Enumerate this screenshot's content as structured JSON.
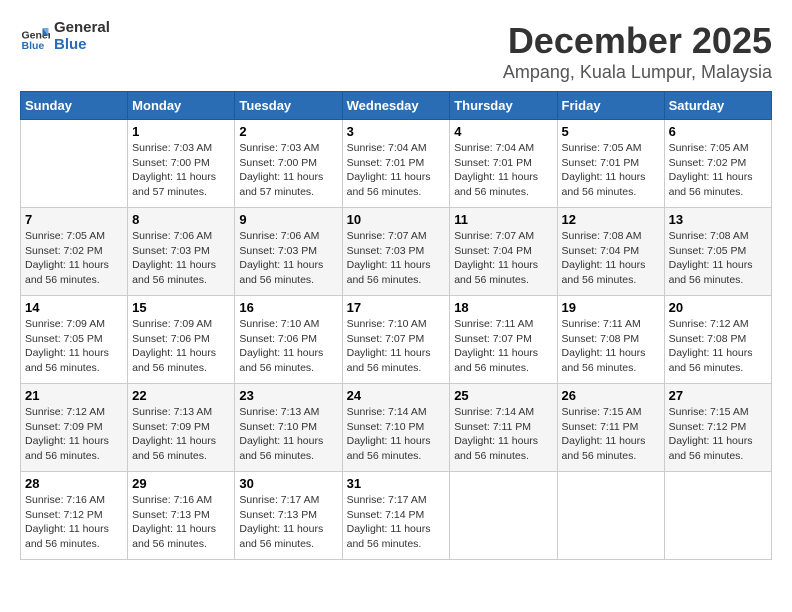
{
  "header": {
    "logo_line1": "General",
    "logo_line2": "Blue",
    "month": "December 2025",
    "location": "Ampang, Kuala Lumpur, Malaysia"
  },
  "days_of_week": [
    "Sunday",
    "Monday",
    "Tuesday",
    "Wednesday",
    "Thursday",
    "Friday",
    "Saturday"
  ],
  "weeks": [
    [
      {
        "day": "",
        "sunrise": "",
        "sunset": "",
        "daylight": ""
      },
      {
        "day": "1",
        "sunrise": "Sunrise: 7:03 AM",
        "sunset": "Sunset: 7:00 PM",
        "daylight": "Daylight: 11 hours and 57 minutes."
      },
      {
        "day": "2",
        "sunrise": "Sunrise: 7:03 AM",
        "sunset": "Sunset: 7:00 PM",
        "daylight": "Daylight: 11 hours and 57 minutes."
      },
      {
        "day": "3",
        "sunrise": "Sunrise: 7:04 AM",
        "sunset": "Sunset: 7:01 PM",
        "daylight": "Daylight: 11 hours and 56 minutes."
      },
      {
        "day": "4",
        "sunrise": "Sunrise: 7:04 AM",
        "sunset": "Sunset: 7:01 PM",
        "daylight": "Daylight: 11 hours and 56 minutes."
      },
      {
        "day": "5",
        "sunrise": "Sunrise: 7:05 AM",
        "sunset": "Sunset: 7:01 PM",
        "daylight": "Daylight: 11 hours and 56 minutes."
      },
      {
        "day": "6",
        "sunrise": "Sunrise: 7:05 AM",
        "sunset": "Sunset: 7:02 PM",
        "daylight": "Daylight: 11 hours and 56 minutes."
      }
    ],
    [
      {
        "day": "7",
        "sunrise": "Sunrise: 7:05 AM",
        "sunset": "Sunset: 7:02 PM",
        "daylight": "Daylight: 11 hours and 56 minutes."
      },
      {
        "day": "8",
        "sunrise": "Sunrise: 7:06 AM",
        "sunset": "Sunset: 7:03 PM",
        "daylight": "Daylight: 11 hours and 56 minutes."
      },
      {
        "day": "9",
        "sunrise": "Sunrise: 7:06 AM",
        "sunset": "Sunset: 7:03 PM",
        "daylight": "Daylight: 11 hours and 56 minutes."
      },
      {
        "day": "10",
        "sunrise": "Sunrise: 7:07 AM",
        "sunset": "Sunset: 7:03 PM",
        "daylight": "Daylight: 11 hours and 56 minutes."
      },
      {
        "day": "11",
        "sunrise": "Sunrise: 7:07 AM",
        "sunset": "Sunset: 7:04 PM",
        "daylight": "Daylight: 11 hours and 56 minutes."
      },
      {
        "day": "12",
        "sunrise": "Sunrise: 7:08 AM",
        "sunset": "Sunset: 7:04 PM",
        "daylight": "Daylight: 11 hours and 56 minutes."
      },
      {
        "day": "13",
        "sunrise": "Sunrise: 7:08 AM",
        "sunset": "Sunset: 7:05 PM",
        "daylight": "Daylight: 11 hours and 56 minutes."
      }
    ],
    [
      {
        "day": "14",
        "sunrise": "Sunrise: 7:09 AM",
        "sunset": "Sunset: 7:05 PM",
        "daylight": "Daylight: 11 hours and 56 minutes."
      },
      {
        "day": "15",
        "sunrise": "Sunrise: 7:09 AM",
        "sunset": "Sunset: 7:06 PM",
        "daylight": "Daylight: 11 hours and 56 minutes."
      },
      {
        "day": "16",
        "sunrise": "Sunrise: 7:10 AM",
        "sunset": "Sunset: 7:06 PM",
        "daylight": "Daylight: 11 hours and 56 minutes."
      },
      {
        "day": "17",
        "sunrise": "Sunrise: 7:10 AM",
        "sunset": "Sunset: 7:07 PM",
        "daylight": "Daylight: 11 hours and 56 minutes."
      },
      {
        "day": "18",
        "sunrise": "Sunrise: 7:11 AM",
        "sunset": "Sunset: 7:07 PM",
        "daylight": "Daylight: 11 hours and 56 minutes."
      },
      {
        "day": "19",
        "sunrise": "Sunrise: 7:11 AM",
        "sunset": "Sunset: 7:08 PM",
        "daylight": "Daylight: 11 hours and 56 minutes."
      },
      {
        "day": "20",
        "sunrise": "Sunrise: 7:12 AM",
        "sunset": "Sunset: 7:08 PM",
        "daylight": "Daylight: 11 hours and 56 minutes."
      }
    ],
    [
      {
        "day": "21",
        "sunrise": "Sunrise: 7:12 AM",
        "sunset": "Sunset: 7:09 PM",
        "daylight": "Daylight: 11 hours and 56 minutes."
      },
      {
        "day": "22",
        "sunrise": "Sunrise: 7:13 AM",
        "sunset": "Sunset: 7:09 PM",
        "daylight": "Daylight: 11 hours and 56 minutes."
      },
      {
        "day": "23",
        "sunrise": "Sunrise: 7:13 AM",
        "sunset": "Sunset: 7:10 PM",
        "daylight": "Daylight: 11 hours and 56 minutes."
      },
      {
        "day": "24",
        "sunrise": "Sunrise: 7:14 AM",
        "sunset": "Sunset: 7:10 PM",
        "daylight": "Daylight: 11 hours and 56 minutes."
      },
      {
        "day": "25",
        "sunrise": "Sunrise: 7:14 AM",
        "sunset": "Sunset: 7:11 PM",
        "daylight": "Daylight: 11 hours and 56 minutes."
      },
      {
        "day": "26",
        "sunrise": "Sunrise: 7:15 AM",
        "sunset": "Sunset: 7:11 PM",
        "daylight": "Daylight: 11 hours and 56 minutes."
      },
      {
        "day": "27",
        "sunrise": "Sunrise: 7:15 AM",
        "sunset": "Sunset: 7:12 PM",
        "daylight": "Daylight: 11 hours and 56 minutes."
      }
    ],
    [
      {
        "day": "28",
        "sunrise": "Sunrise: 7:16 AM",
        "sunset": "Sunset: 7:12 PM",
        "daylight": "Daylight: 11 hours and 56 minutes."
      },
      {
        "day": "29",
        "sunrise": "Sunrise: 7:16 AM",
        "sunset": "Sunset: 7:13 PM",
        "daylight": "Daylight: 11 hours and 56 minutes."
      },
      {
        "day": "30",
        "sunrise": "Sunrise: 7:17 AM",
        "sunset": "Sunset: 7:13 PM",
        "daylight": "Daylight: 11 hours and 56 minutes."
      },
      {
        "day": "31",
        "sunrise": "Sunrise: 7:17 AM",
        "sunset": "Sunset: 7:14 PM",
        "daylight": "Daylight: 11 hours and 56 minutes."
      },
      {
        "day": "",
        "sunrise": "",
        "sunset": "",
        "daylight": ""
      },
      {
        "day": "",
        "sunrise": "",
        "sunset": "",
        "daylight": ""
      },
      {
        "day": "",
        "sunrise": "",
        "sunset": "",
        "daylight": ""
      }
    ]
  ]
}
